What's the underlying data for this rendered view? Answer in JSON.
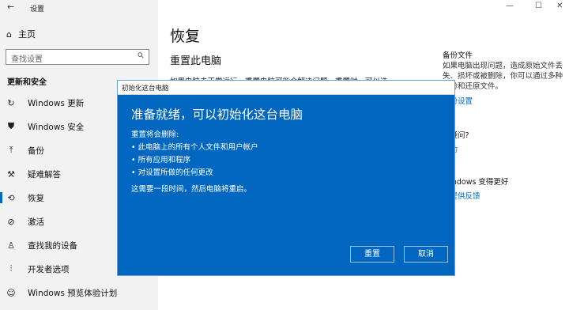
{
  "window": {
    "title": "设置",
    "back_glyph": "←",
    "minimize": "—",
    "maximize": "☐",
    "close": "✕"
  },
  "sidebar": {
    "home": "主页",
    "search_placeholder": "查找设置",
    "section": "更新和安全",
    "items": [
      {
        "label": "Windows 更新",
        "icon": "sync-icon",
        "glyph": "↻"
      },
      {
        "label": "Windows 安全",
        "icon": "shield-icon",
        "glyph": "⛊"
      },
      {
        "label": "备份",
        "icon": "upload-icon",
        "glyph": "⤒"
      },
      {
        "label": "疑难解答",
        "icon": "wrench-icon",
        "glyph": "⚒"
      },
      {
        "label": "恢复",
        "icon": "history-icon",
        "glyph": "⟲"
      },
      {
        "label": "激活",
        "icon": "check-circle-icon",
        "glyph": "⊘"
      },
      {
        "label": "查找我的设备",
        "icon": "person-pin-icon",
        "glyph": "♙"
      },
      {
        "label": "开发者选项",
        "icon": "dev-tools-icon",
        "glyph": "⫶"
      },
      {
        "label": "Windows 预览体验计划",
        "icon": "smiley-icon",
        "glyph": "☺"
      }
    ]
  },
  "main": {
    "title": "恢复",
    "subtitle": "重置此电脑",
    "text": "如果电脑未正常运行，重置电脑可能会解决问题。重置时，可以选"
  },
  "right_panel": {
    "backup_title": "备份文件",
    "backup_lines": [
      "如果电脑出现问题，造成原始文件丢",
      "失、损坏或被删除，你可以通过多种",
      "备份和还原文件。"
    ],
    "backup_link": "备份设置",
    "question": "么疑问?",
    "help_link": "帮助",
    "improve": "Windows 变得更好",
    "feedback_link": "们提供反馈"
  },
  "dialog": {
    "title": "初始化这台电脑",
    "heading": "准备就绪，可以初始化这台电脑",
    "intro": "重置将会删除:",
    "bullets": [
      "• 此电脑上的所有个人文件和用户帐户",
      "• 所有应用和程序",
      "• 对设置所做的任何更改"
    ],
    "note": "这需要一段时间，然后电脑将重启。",
    "reset_button": "重置",
    "cancel_button": "取消"
  }
}
